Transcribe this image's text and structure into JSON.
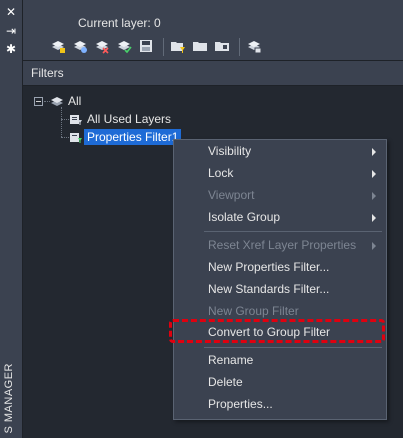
{
  "palette": {
    "title": "S MANAGER",
    "close_glyph": "✕",
    "pin_glyph": "⇥",
    "settings_glyph": "✱"
  },
  "header": {
    "current_layer_label": "Current layer: 0"
  },
  "toolbar": {
    "buttons": [
      {
        "icon": "new-layer-icon"
      },
      {
        "icon": "new-layer-vp-frozen-icon"
      },
      {
        "icon": "delete-layer-icon"
      },
      {
        "icon": "set-current-icon"
      },
      {
        "icon": "save-icon"
      },
      {
        "icon": "new-property-filter-icon"
      },
      {
        "icon": "new-group-filter-icon"
      },
      {
        "icon": "layer-states-icon"
      },
      {
        "icon": "settings-icon"
      }
    ]
  },
  "filters": {
    "header": "Filters",
    "tree": {
      "root": "All",
      "children": [
        "All Used Layers",
        "Properties Filter1"
      ]
    }
  },
  "context_menu": {
    "items": [
      {
        "label": "Visibility",
        "submenu": true,
        "enabled": true
      },
      {
        "label": "Lock",
        "submenu": true,
        "enabled": true
      },
      {
        "label": "Viewport",
        "submenu": true,
        "enabled": false
      },
      {
        "label": "Isolate Group",
        "submenu": true,
        "enabled": true
      },
      {
        "label": "Reset Xref Layer Properties",
        "submenu": true,
        "enabled": false
      },
      {
        "label": "New Properties Filter...",
        "submenu": false,
        "enabled": true
      },
      {
        "label": "New Standards Filter...",
        "submenu": false,
        "enabled": true
      },
      {
        "label": "New Group Filter",
        "submenu": false,
        "enabled": false
      },
      {
        "label": "Convert to Group Filter",
        "submenu": false,
        "enabled": true,
        "highlighted": true
      },
      {
        "label": "Rename",
        "submenu": false,
        "enabled": true
      },
      {
        "label": "Delete",
        "submenu": false,
        "enabled": true
      },
      {
        "label": "Properties...",
        "submenu": false,
        "enabled": true
      }
    ]
  },
  "colors": {
    "panel": "#3b4250",
    "tree_bg": "#232830",
    "selection": "#1e6bd6",
    "highlight_border": "#e0000f"
  }
}
